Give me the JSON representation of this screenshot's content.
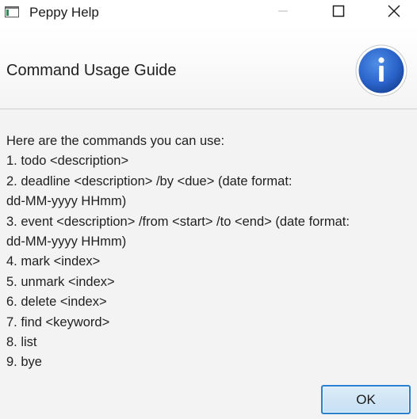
{
  "window": {
    "title": "Peppy Help",
    "controls": [
      "minimize",
      "maximize",
      "close"
    ]
  },
  "header": {
    "title": "Command Usage Guide",
    "icon": "info-icon",
    "icon_color": "#2a63c9"
  },
  "content": {
    "lines": [
      "Here are the commands you can use:",
      "1. todo <description>",
      "2. deadline <description> /by <due> (date format:",
      "dd-MM-yyyy HHmm)",
      "3. event <description> /from <start> /to <end> (date format:",
      "dd-MM-yyyy HHmm)",
      "4. mark <index>",
      "5. unmark <index>",
      "6. delete <index>",
      "7. find <keyword>",
      "8. list",
      "9. bye"
    ]
  },
  "buttons": {
    "ok_label": "OK"
  },
  "colors": {
    "accent": "#2b7fd0",
    "ok_fill": "#cfe6f7"
  }
}
